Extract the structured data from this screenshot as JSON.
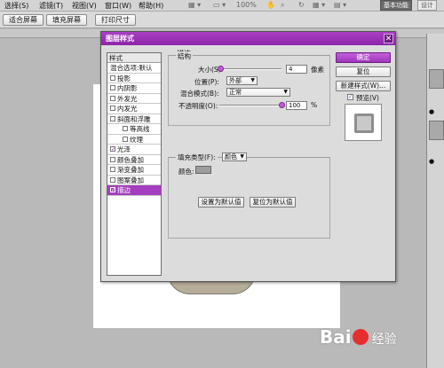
{
  "menubar": {
    "items": [
      "选择(S)",
      "滤镜(T)",
      "视图(V)",
      "窗口(W)",
      "帮助(H)"
    ],
    "zoom": "100%",
    "workspace_active": "基本功能",
    "workspace_other": "设计"
  },
  "options_bar": {
    "buttons": [
      "适合屏幕",
      "填充屏幕",
      "打印尺寸"
    ]
  },
  "dialog": {
    "title": "图层样式",
    "close_glyph": "✕",
    "style_list": {
      "header": "样式",
      "items": [
        {
          "label": "混合选项:默认",
          "checkbox": false,
          "checked": false,
          "sub": false,
          "selected": false
        },
        {
          "label": "投影",
          "checkbox": true,
          "checked": false,
          "sub": false,
          "selected": false
        },
        {
          "label": "内阴影",
          "checkbox": true,
          "checked": false,
          "sub": false,
          "selected": false
        },
        {
          "label": "外发光",
          "checkbox": true,
          "checked": false,
          "sub": false,
          "selected": false
        },
        {
          "label": "内发光",
          "checkbox": true,
          "checked": false,
          "sub": false,
          "selected": false
        },
        {
          "label": "斜面和浮雕",
          "checkbox": true,
          "checked": false,
          "sub": false,
          "selected": false
        },
        {
          "label": "等高线",
          "checkbox": true,
          "checked": false,
          "sub": true,
          "selected": false
        },
        {
          "label": "纹理",
          "checkbox": true,
          "checked": false,
          "sub": true,
          "selected": false
        },
        {
          "label": "光泽",
          "checkbox": true,
          "checked": true,
          "sub": false,
          "selected": false
        },
        {
          "label": "颜色叠加",
          "checkbox": true,
          "checked": false,
          "sub": false,
          "selected": false
        },
        {
          "label": "渐变叠加",
          "checkbox": true,
          "checked": false,
          "sub": false,
          "selected": false
        },
        {
          "label": "图案叠加",
          "checkbox": true,
          "checked": false,
          "sub": false,
          "selected": false
        },
        {
          "label": "描边",
          "checkbox": true,
          "checked": true,
          "sub": false,
          "selected": true
        }
      ]
    },
    "stroke": {
      "section_title": "描边",
      "structure_title": "结构",
      "size_label": "大小(S):",
      "size_value": "4",
      "size_unit": "像素",
      "size_fraction": 0.02,
      "position_label": "位置(P):",
      "position_value": "外部",
      "blend_label": "混合模式(B):",
      "blend_value": "正常",
      "opacity_label": "不透明度(O):",
      "opacity_value": "100",
      "opacity_unit": "%",
      "opacity_fraction": 1.0,
      "fill_type_label": "填充类型(F):",
      "fill_type_value": "颜色",
      "color_label": "颜色:",
      "color_value": "#9d9d9d"
    },
    "default_buttons": {
      "set_default": "设置为默认值",
      "reset_default": "复位为默认值"
    },
    "side_buttons": {
      "ok": "确定",
      "reset": "复位",
      "new_style": "新建样式(W)...",
      "preview_label": "预览(V)",
      "preview_checked": true
    },
    "accent_color": "#a43ec0"
  },
  "watermark": {
    "text_left": "Bai",
    "text_right": "经验"
  }
}
